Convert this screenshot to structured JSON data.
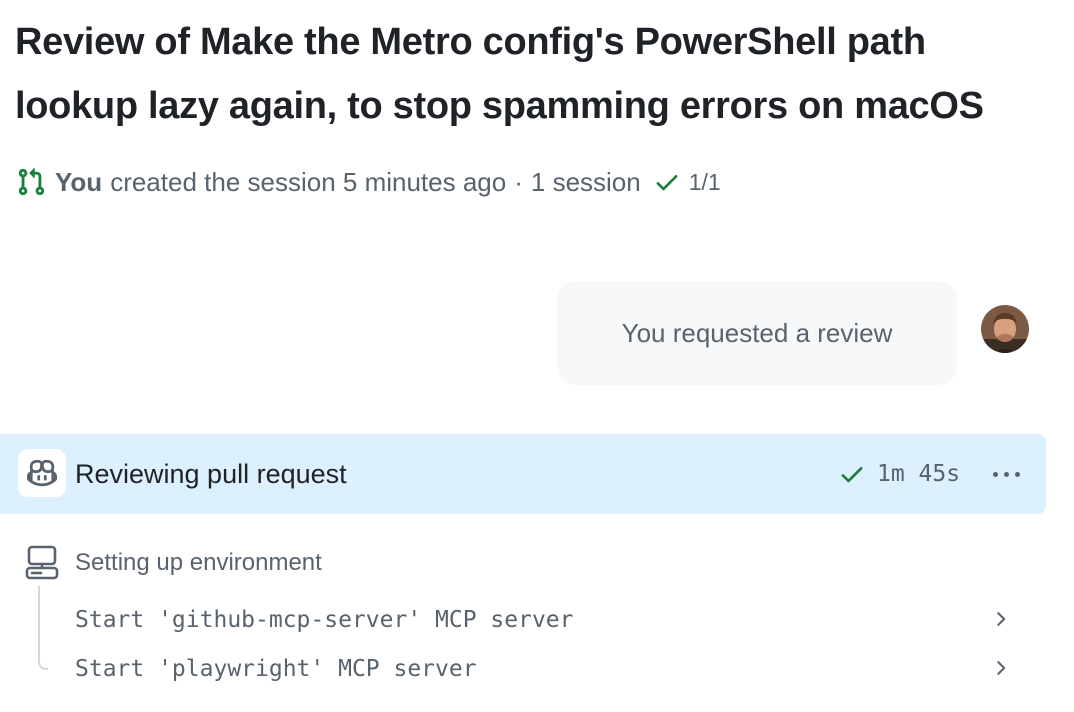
{
  "header": {
    "title": "Review of Make the Metro config's PowerShell path lookup lazy again, to stop spamming errors on macOS"
  },
  "meta": {
    "icon": "git-pull-request-icon",
    "actor": "You",
    "action": "created the session 5 minutes ago",
    "separator": "·",
    "sessions": "1 session",
    "status_icon": "check-icon",
    "progress": "1/1"
  },
  "message": {
    "text": "You requested a review",
    "avatar_icon": "user-avatar"
  },
  "review": {
    "icon": "copilot-icon",
    "title": "Reviewing pull request",
    "status_icon": "check-icon",
    "duration": "1m 45s",
    "menu_icon": "kebab-horizontal-icon"
  },
  "environment": {
    "icon": "server-icon",
    "label": "Setting up environment",
    "steps": [
      {
        "text": "Start 'github-mcp-server' MCP server",
        "icon": "chevron-right-icon"
      },
      {
        "text": "Start 'playwright' MCP server",
        "icon": "chevron-right-icon"
      }
    ]
  },
  "colors": {
    "success": "#1a7f37",
    "row_highlight": "#ddf0fd",
    "bubble_bg": "#f6f8fa",
    "muted_text": "#59636e",
    "primary_text": "#1f2328"
  }
}
